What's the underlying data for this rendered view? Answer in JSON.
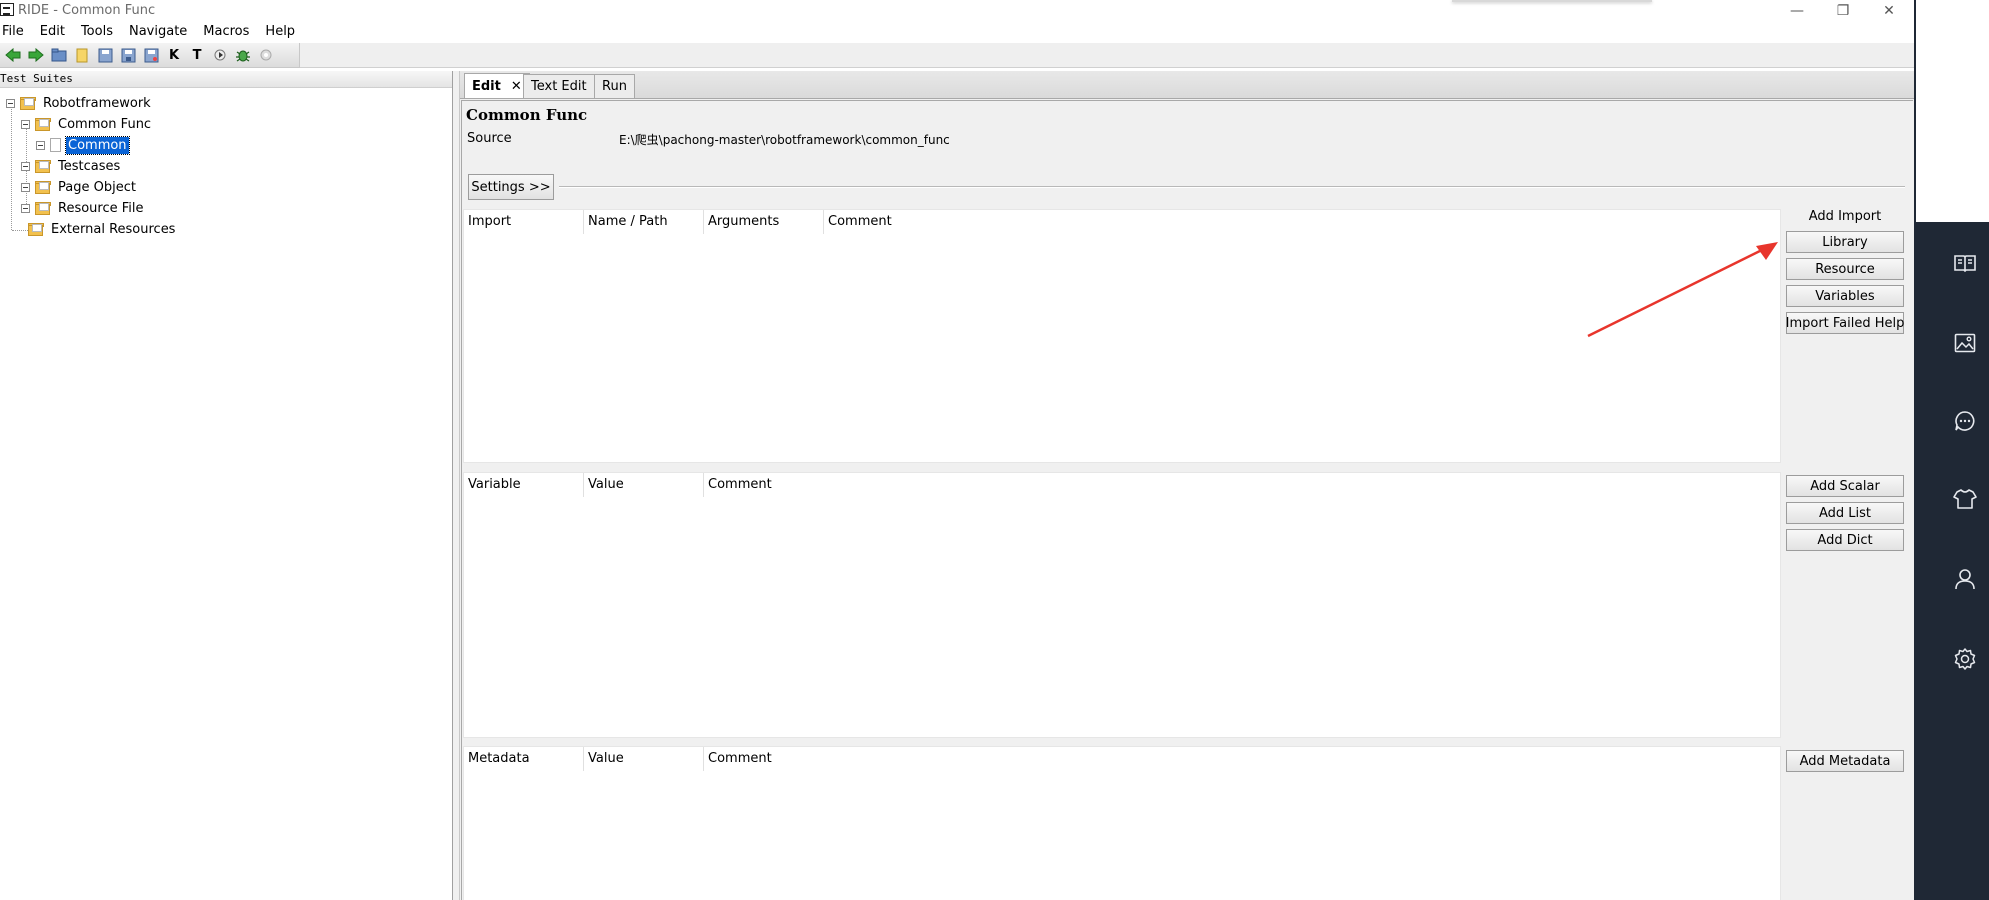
{
  "window": {
    "title": "RIDE - Common Func",
    "minimize": "—",
    "restore": "❐",
    "close": "✕"
  },
  "menu": [
    "File",
    "Edit",
    "Tools",
    "Navigate",
    "Macros",
    "Help"
  ],
  "toolbar": {
    "icons": [
      "back-arrow-icon",
      "forward-arrow-icon",
      "open-folder-icon",
      "new-file-icon",
      "save-icon",
      "save-all-icon",
      "save-as-icon",
      "keyword-search-icon",
      "test-search-icon",
      "run-icon",
      "debug-bug-icon",
      "stop-icon"
    ],
    "k_label": "K",
    "t_label": "T"
  },
  "left_panel": {
    "header": "Test Suites",
    "tree": [
      {
        "label": "Robotframework",
        "level": 0
      },
      {
        "label": "Common Func",
        "level": 1
      },
      {
        "label": "Common",
        "level": 2,
        "selected": true
      },
      {
        "label": "Testcases",
        "level": 1
      },
      {
        "label": "Page Object",
        "level": 1
      },
      {
        "label": "Resource File",
        "level": 1
      },
      {
        "label": "External Resources",
        "level": 0
      }
    ]
  },
  "tabs": [
    {
      "label": "Edit",
      "active": true,
      "close": "✕"
    },
    {
      "label": "Text Edit",
      "active": false
    },
    {
      "label": "Run",
      "active": false
    }
  ],
  "editor": {
    "title": "Common Func",
    "source_label": "Source",
    "source_value": "E:\\爬虫\\pachong-master\\robotframework\\common_func",
    "settings_button": "Settings >>",
    "import_table": {
      "columns": [
        "Import",
        "Name / Path",
        "Arguments",
        "Comment"
      ]
    },
    "variable_table": {
      "columns": [
        "Variable",
        "Value",
        "Comment"
      ]
    },
    "metadata_table": {
      "columns": [
        "Metadata",
        "Value",
        "Comment"
      ]
    },
    "import_buttons": {
      "heading": "Add Import",
      "library": "Library",
      "resource": "Resource",
      "variables": "Variables",
      "import_failed_help": "Import Failed Help"
    },
    "variable_buttons": {
      "add_scalar": "Add Scalar",
      "add_list": "Add List",
      "add_dict": "Add Dict"
    },
    "metadata_buttons": {
      "add_metadata": "Add Metadata"
    }
  },
  "right_sidebar": {
    "icons": [
      "book-icon",
      "image-icon",
      "chat-bubble-icon",
      "tshirt-icon",
      "user-icon",
      "settings-gear-icon"
    ]
  },
  "colors": {
    "selection": "#0a64d6",
    "sidebar_dark": "#1f2835",
    "annotation_arrow": "#e8352c"
  }
}
